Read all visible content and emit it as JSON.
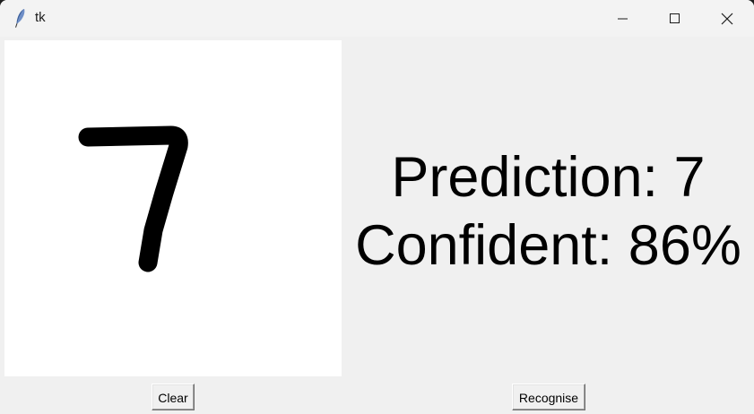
{
  "window": {
    "title": "tk",
    "icon": "tk-feather-icon",
    "controls": {
      "minimize_icon": "minimize-icon",
      "maximize_icon": "maximize-icon",
      "close_icon": "close-icon"
    }
  },
  "canvas": {
    "drawn_digit": "7",
    "background": "#ffffff",
    "stroke_color": "#000000"
  },
  "result": {
    "prediction_text": "Prediction: 7",
    "confidence_text": "Confident: 86%"
  },
  "buttons": {
    "clear_label": "Clear",
    "recognise_label": "Recognise"
  }
}
